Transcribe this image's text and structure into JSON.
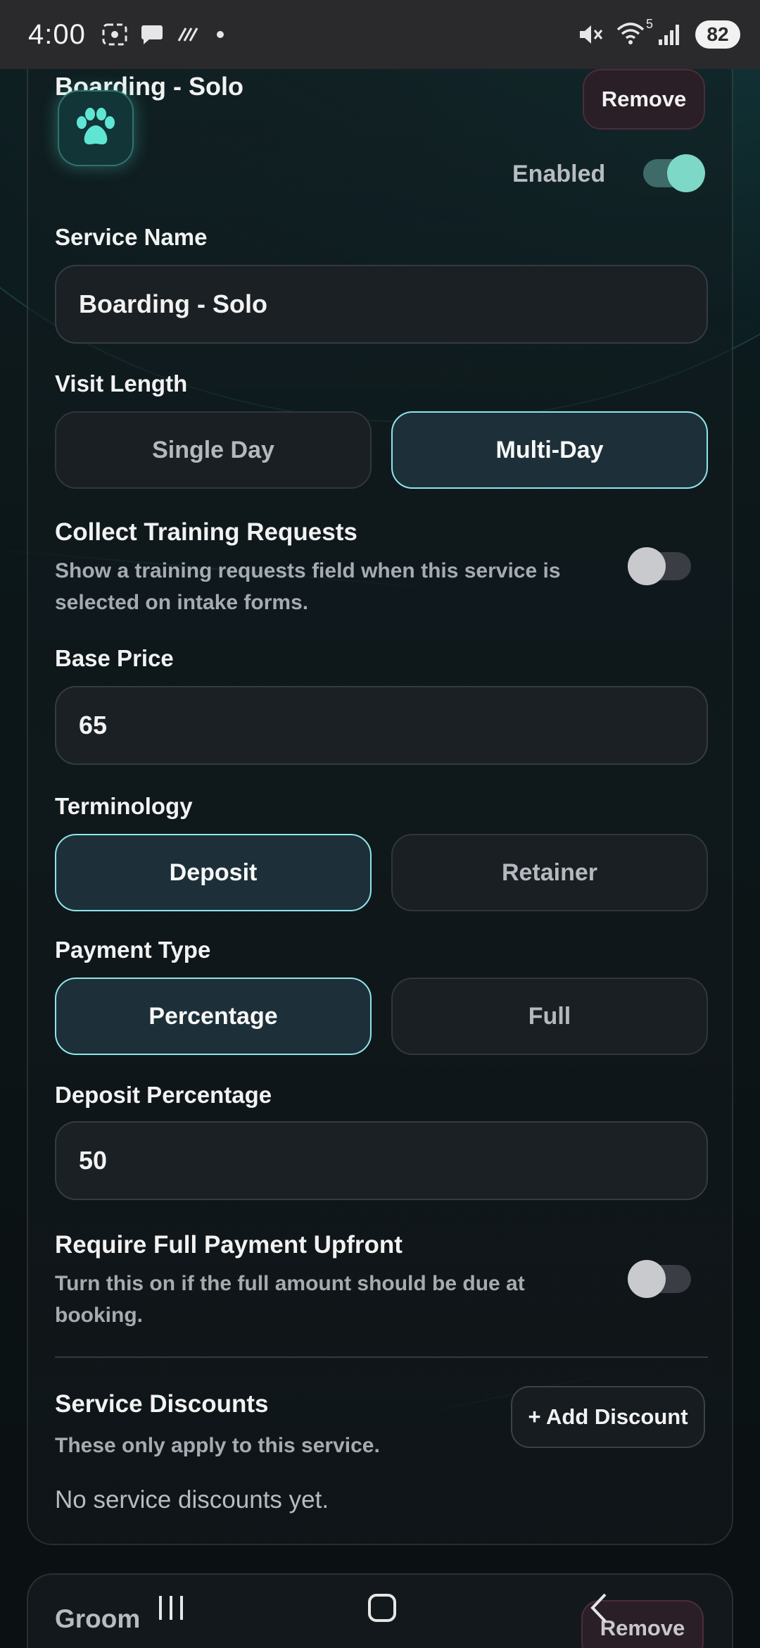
{
  "status_bar": {
    "time": "4:00",
    "battery": "82",
    "signal_sup": "5"
  },
  "service_card": {
    "title": "Boarding - Solo",
    "remove_label": "Remove",
    "enabled_label": "Enabled",
    "enabled": true,
    "service_name": {
      "label": "Service Name",
      "value": "Boarding - Solo"
    },
    "visit_length": {
      "label": "Visit Length",
      "options": [
        "Single Day",
        "Multi-Day"
      ],
      "selected": "Multi-Day"
    },
    "training_requests": {
      "label": "Collect Training Requests",
      "description": "Show a training requests field when this service is selected on intake forms.",
      "enabled": false
    },
    "base_price": {
      "label": "Base Price",
      "value": "65"
    },
    "terminology": {
      "label": "Terminology",
      "options": [
        "Deposit",
        "Retainer"
      ],
      "selected": "Deposit"
    },
    "payment_type": {
      "label": "Payment Type",
      "options": [
        "Percentage",
        "Full"
      ],
      "selected": "Percentage"
    },
    "deposit_percentage": {
      "label": "Deposit Percentage",
      "value": "50"
    },
    "full_payment_upfront": {
      "label": "Require Full Payment Upfront",
      "description": "Turn this on if the full amount should be due at booking.",
      "enabled": false
    },
    "discounts": {
      "label": "Service Discounts",
      "description": "These only apply to this service.",
      "add_label": "+ Add Discount",
      "empty_text": "No service discounts yet."
    }
  },
  "next_card": {
    "title": "Groom",
    "remove_label": "Remove"
  },
  "colors": {
    "accent": "#7dd8c8",
    "active_border": "#8ee6ea",
    "card_bg": "#111e21"
  }
}
